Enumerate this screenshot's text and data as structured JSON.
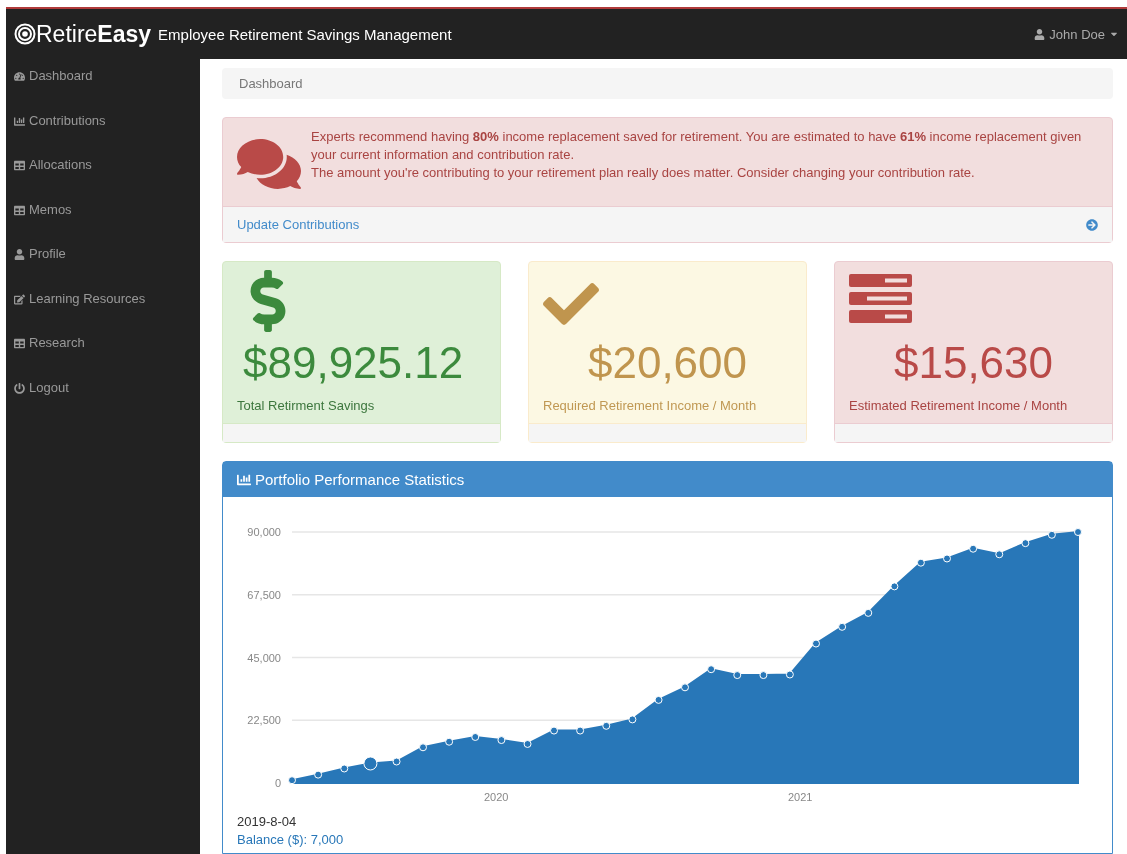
{
  "navbar": {
    "brand": "Retire**Easy**",
    "subtitle": "Employee Retirement Savings Management",
    "user": "John Doe"
  },
  "sidebar": {
    "items": [
      {
        "label": "Dashboard"
      },
      {
        "label": "Contributions"
      },
      {
        "label": "Allocations"
      },
      {
        "label": "Memos"
      },
      {
        "label": "Profile"
      },
      {
        "label": "Learning Resources"
      },
      {
        "label": "Research"
      },
      {
        "label": "Logout"
      }
    ]
  },
  "breadcrumb": "Dashboard",
  "alert": {
    "lines": [
      "Experts recommend having **80%** income replacement saved for retirement. You are estimated to have **61%** income replacement given your current information and contribution rate.",
      "The amount you're contributing to your retirement plan really does matter. Consider changing your contribution rate."
    ],
    "link": "Update Contributions"
  },
  "cards": [
    {
      "kind": "success",
      "value": "$89,925.12",
      "label": "Total Retirment Savings"
    },
    {
      "kind": "warning",
      "value": "$20,600",
      "label": "Required Retirement Income / Month"
    },
    {
      "kind": "danger",
      "value": "$15,630",
      "label": "Estimated Retirement Income / Month"
    }
  ],
  "panel": {
    "title": "Portfolio Performance Statistics",
    "chart_data": {
      "type": "area",
      "x": [
        2019.328,
        2019.414,
        2019.5,
        2019.586,
        2019.672,
        2019.759,
        2019.845,
        2019.931,
        2020.017,
        2020.103,
        2020.19,
        2020.276,
        2020.362,
        2020.448,
        2020.534,
        2020.621,
        2020.707,
        2020.793,
        2020.879,
        2020.966,
        2021.052,
        2021.138,
        2021.224,
        2021.31,
        2021.397,
        2021.483,
        2021.569,
        2021.655,
        2021.741,
        2021.828,
        2021.914
      ],
      "series": [
        {
          "name": "Balance ($)",
          "color": "#2877b8",
          "values": [
            1000,
            3000,
            5200,
            7000,
            7700,
            12800,
            14800,
            16500,
            15400,
            14000,
            18800,
            18800,
            20500,
            22800,
            29800,
            34300,
            40800,
            38700,
            38700,
            38900,
            50000,
            56000,
            61000,
            70500,
            79000,
            80500,
            84000,
            82000,
            86000,
            89000,
            90000
          ]
        }
      ],
      "ylim": [
        0,
        90000
      ],
      "yticks": [
        {
          "value": 0,
          "label": "0"
        },
        {
          "value": 22500,
          "label": "22,500"
        },
        {
          "value": 45000,
          "label": "45,000"
        },
        {
          "value": 67500,
          "label": "67,500"
        },
        {
          "value": 90000,
          "label": "90,000"
        }
      ],
      "xlim": [
        2019.328,
        2021.914
      ],
      "grid": true,
      "xticks": [
        2020,
        2021
      ],
      "annotations": [
        "2019-8-04"
      ]
    },
    "points": [
      {
        "selected": false
      },
      {
        "selected": false
      },
      {
        "selected": false
      },
      {
        "selected": true
      },
      {
        "selected": false
      },
      {
        "selected": false
      },
      {
        "selected": false
      },
      {
        "selected": false
      },
      {
        "selected": false
      },
      {
        "selected": false
      },
      {
        "selected": false
      },
      {
        "selected": false
      },
      {
        "selected": false
      },
      {
        "selected": false
      },
      {
        "selected": false
      },
      {
        "selected": false
      },
      {
        "selected": false
      },
      {
        "selected": false
      },
      {
        "selected": false
      },
      {
        "selected": false
      },
      {
        "selected": false
      },
      {
        "selected": false
      },
      {
        "selected": false
      },
      {
        "selected": false
      },
      {
        "selected": false
      },
      {
        "selected": false
      },
      {
        "selected": false
      },
      {
        "selected": false
      },
      {
        "selected": false
      },
      {
        "selected": false
      },
      {
        "selected": false
      }
    ],
    "tooltip": {
      "separator": ":",
      "value": "7,000"
    }
  }
}
